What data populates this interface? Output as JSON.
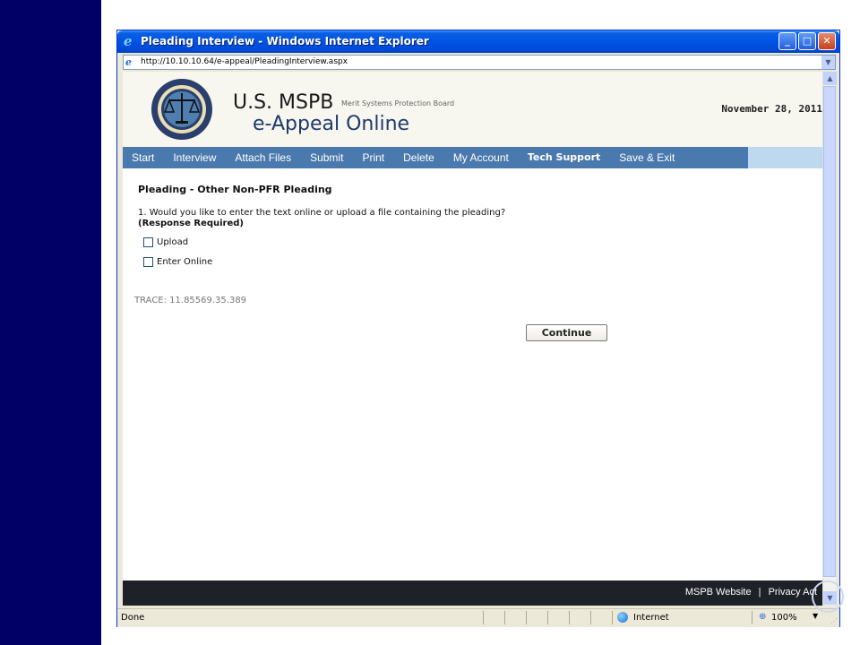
{
  "window": {
    "title": "Pleading Interview - Windows Internet Explorer",
    "url": "http://10.10.10.64/e-appeal/PleadingInterview.aspx",
    "minimize_glyph": "_",
    "maximize_glyph": "□",
    "close_glyph": "✕"
  },
  "header": {
    "brand_line1": "U.S. MSPB",
    "brand_tag": "Merit Systems Protection Board",
    "brand_line2": "e-Appeal Online",
    "date": "November 28, 2011"
  },
  "nav": {
    "items": [
      {
        "label": "Start"
      },
      {
        "label": "Interview"
      },
      {
        "label": "Attach Files"
      },
      {
        "label": "Submit"
      },
      {
        "label": "Print"
      },
      {
        "label": "Delete"
      },
      {
        "label": "My Account"
      },
      {
        "label": "Tech Support"
      },
      {
        "label": "Save & Exit"
      }
    ]
  },
  "form": {
    "section_title": "Pleading - Other Non-PFR Pleading",
    "question": "1. Would you like to enter the text online or upload a file containing the pleading?",
    "required_note": "(Response Required)",
    "options": [
      {
        "label": "Upload",
        "checked": false
      },
      {
        "label": "Enter Online",
        "checked": false
      }
    ],
    "trace": "TRACE: 11.85569.35.389",
    "continue_label": "Continue"
  },
  "footer": {
    "website_link": "MSPB Website",
    "separator": "|",
    "privacy_link": "Privacy Act"
  },
  "statusbar": {
    "status": "Done",
    "zone": "Internet",
    "zoom": "100%"
  },
  "colors": {
    "left_strip": "#000066",
    "nav_bg": "#4a79ad",
    "footer_bg": "#1f2128",
    "titlebar": "#0054e3"
  }
}
